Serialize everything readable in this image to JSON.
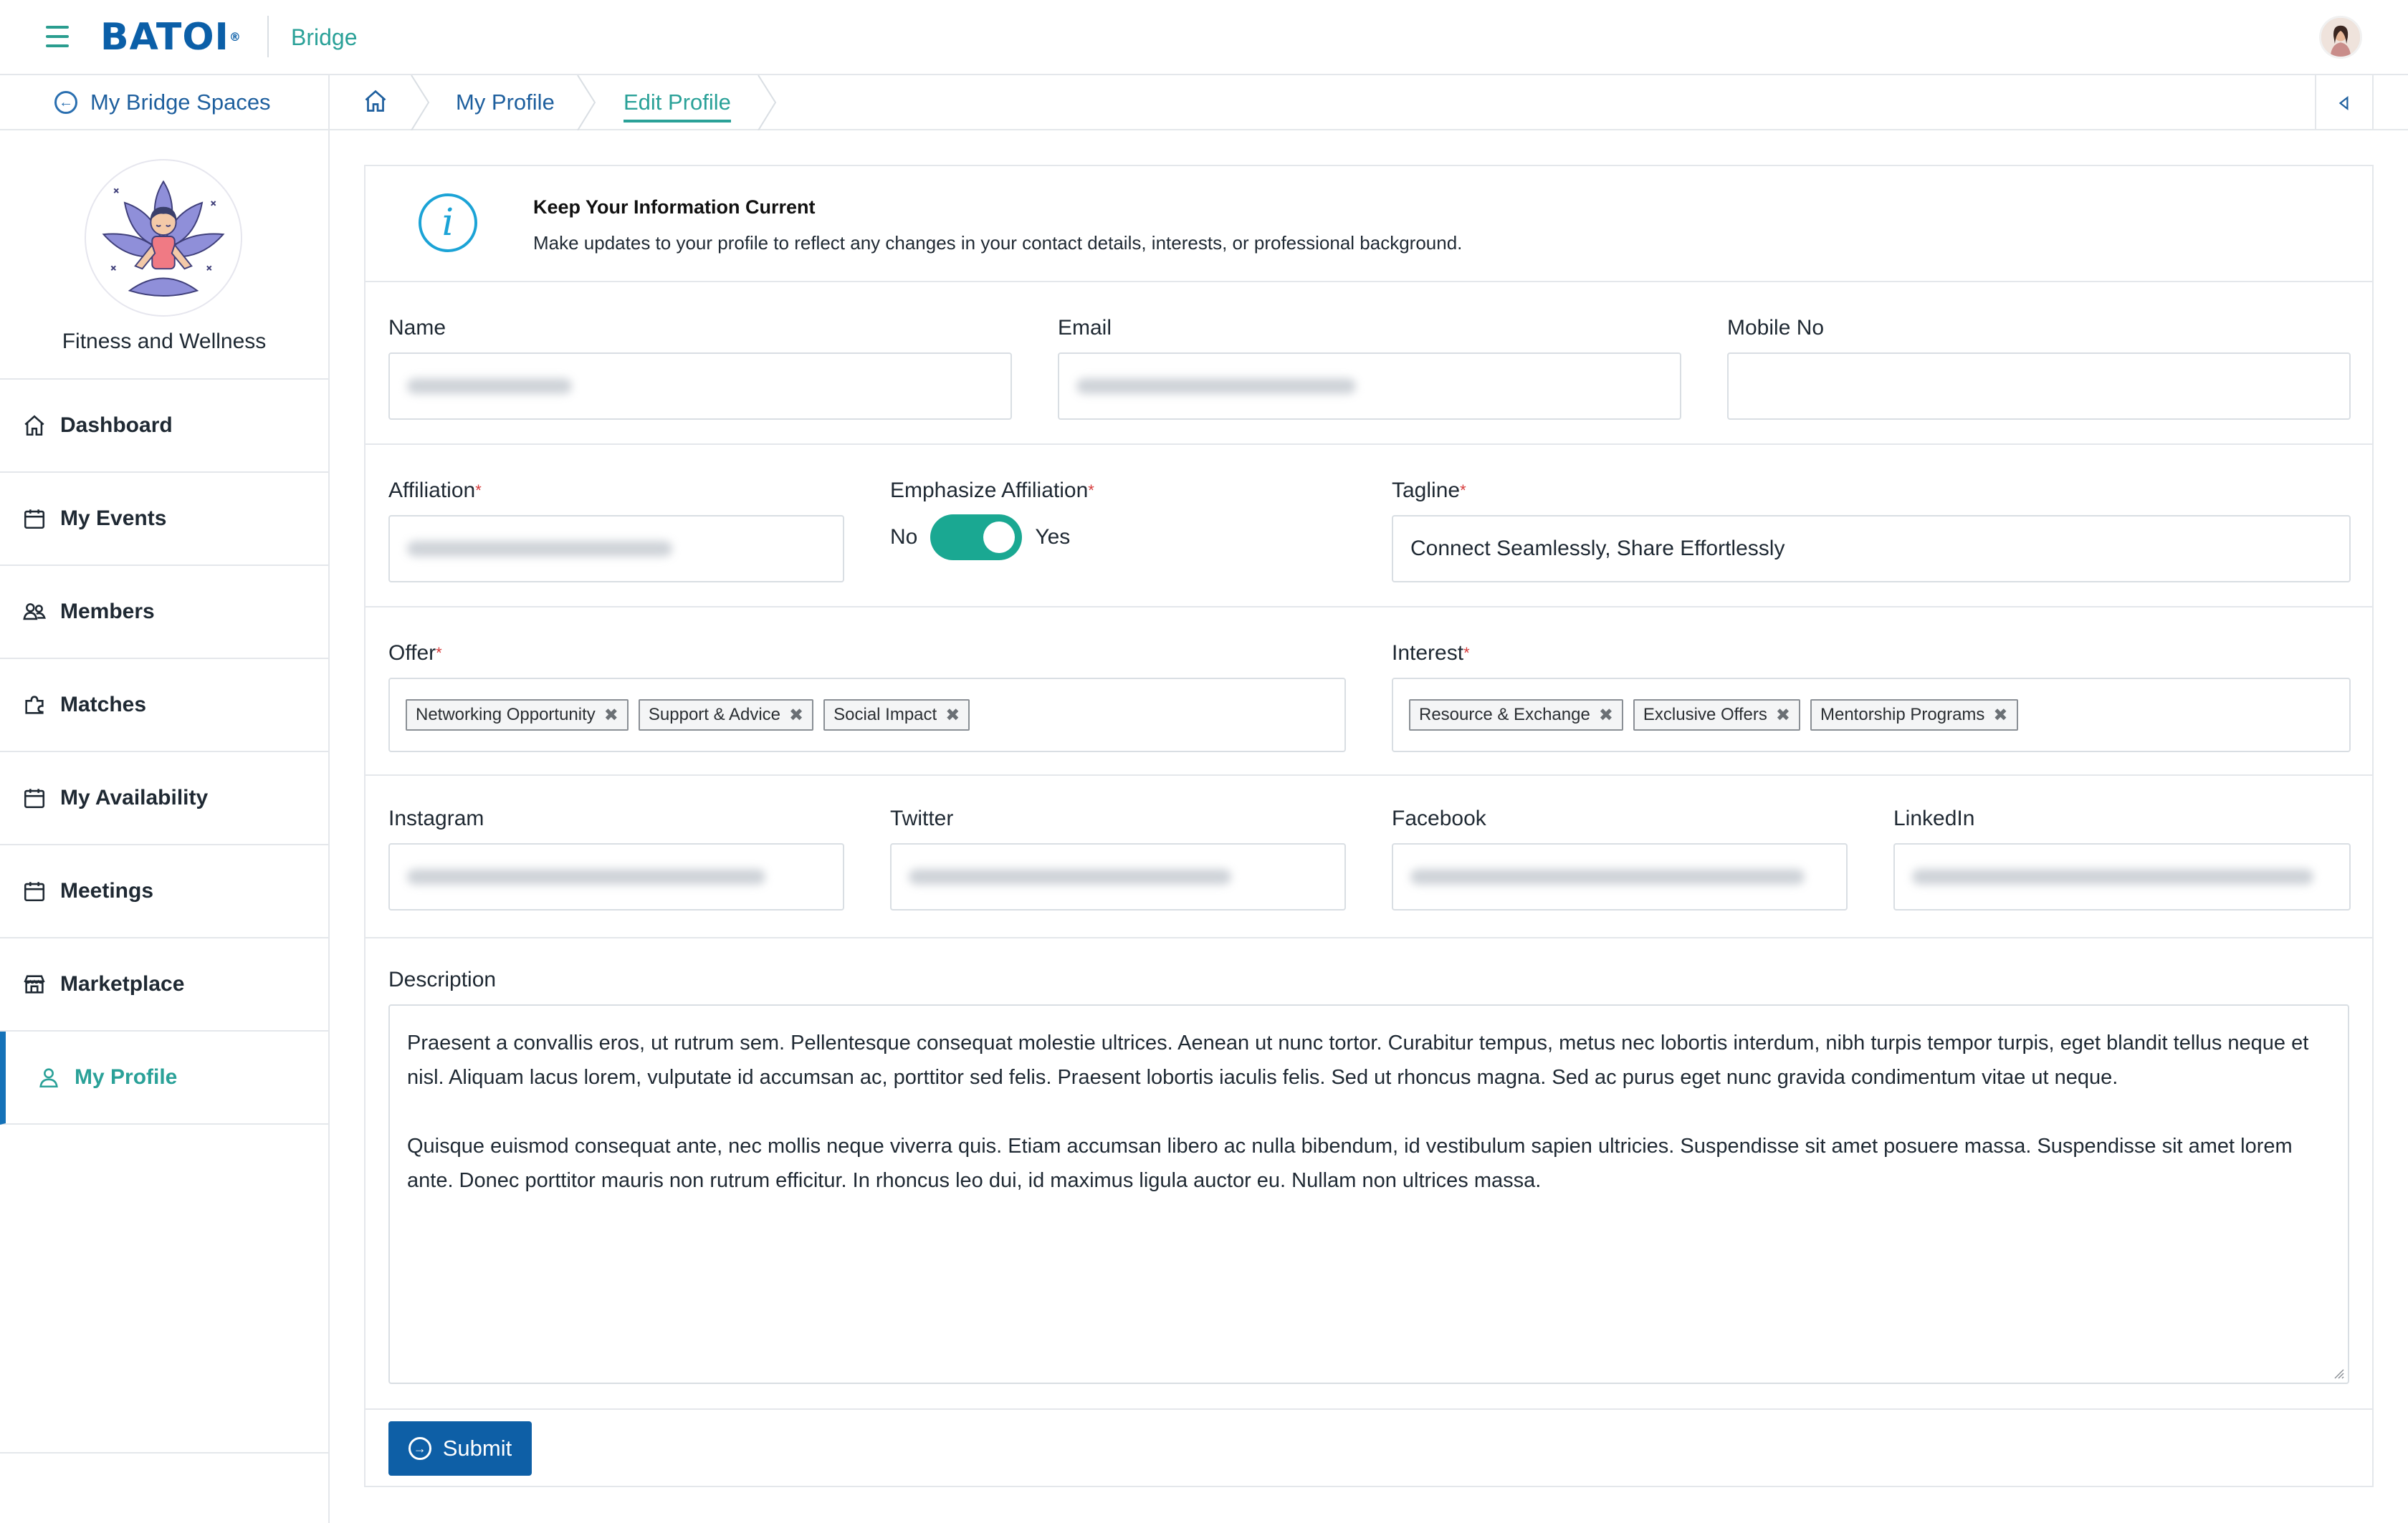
{
  "header": {
    "logo": "BATOI",
    "logo_reg": "®",
    "app_name": "Bridge"
  },
  "sidebar": {
    "back_link": "My Bridge Spaces",
    "space_name": "Fitness and Wellness",
    "items": [
      {
        "label": "Dashboard",
        "icon": "home-icon"
      },
      {
        "label": "My Events",
        "icon": "calendar-icon"
      },
      {
        "label": "Members",
        "icon": "users-icon"
      },
      {
        "label": "Matches",
        "icon": "puzzle-icon"
      },
      {
        "label": "My Availability",
        "icon": "calendar-icon"
      },
      {
        "label": "Meetings",
        "icon": "calendar-icon"
      },
      {
        "label": "Marketplace",
        "icon": "store-icon"
      },
      {
        "label": "My Profile",
        "icon": "user-icon",
        "active": true
      }
    ]
  },
  "breadcrumb": {
    "items": [
      "My Profile",
      "Edit Profile"
    ]
  },
  "info": {
    "title": "Keep Your Information Current",
    "text": "Make updates to your profile to reflect any changes in your contact details, interests, or professional background."
  },
  "form": {
    "name_label": "Name",
    "email_label": "Email",
    "mobile_label": "Mobile No",
    "affiliation_label": "Affiliation",
    "emphasize_label": "Emphasize Affiliation",
    "toggle_no": "No",
    "toggle_yes": "Yes",
    "toggle_value": true,
    "tagline_label": "Tagline",
    "tagline_value": "Connect Seamlessly, Share Effortlessly",
    "required_mark": "*",
    "offer_label": "Offer",
    "offer_tags": [
      "Networking Opportunity",
      "Support & Advice",
      "Social Impact"
    ],
    "interest_label": "Interest",
    "interest_tags": [
      "Resource & Exchange",
      "Exclusive Offers",
      "Mentorship Programs"
    ],
    "instagram_label": "Instagram",
    "twitter_label": "Twitter",
    "facebook_label": "Facebook",
    "linkedin_label": "LinkedIn",
    "description_label": "Description",
    "description_p1": "Praesent a convallis eros, ut rutrum sem. Pellentesque consequat molestie ultrices. Aenean ut nunc tortor. Curabitur tempus, metus nec lobortis interdum, nibh turpis tempor turpis, eget blandit tellus neque et nisl. Aliquam lacus lorem, vulputate id accumsan ac, porttitor sed felis. Praesent lobortis iaculis felis. Sed ut rhoncus magna. Sed ac purus eget nunc gravida condimentum vitae ut neque.",
    "description_p2": "Quisque euismod consequat ante, nec mollis neque viverra quis. Etiam accumsan libero ac nulla bibendum, id vestibulum sapien ultricies. Suspendisse sit amet posuere massa. Suspendisse sit amet lorem ante. Donec porttitor mauris non rutrum efficitur. In rhoncus leo dui, id maximus ligula auctor eu. Nullam non ultrices massa.",
    "submit_label": "Submit",
    "tag_remove": "✖"
  },
  "colors": {
    "accent": "#2aa198",
    "primary": "#0e5fa6",
    "toggle_on": "#1aa892",
    "required": "#d63a3a"
  }
}
